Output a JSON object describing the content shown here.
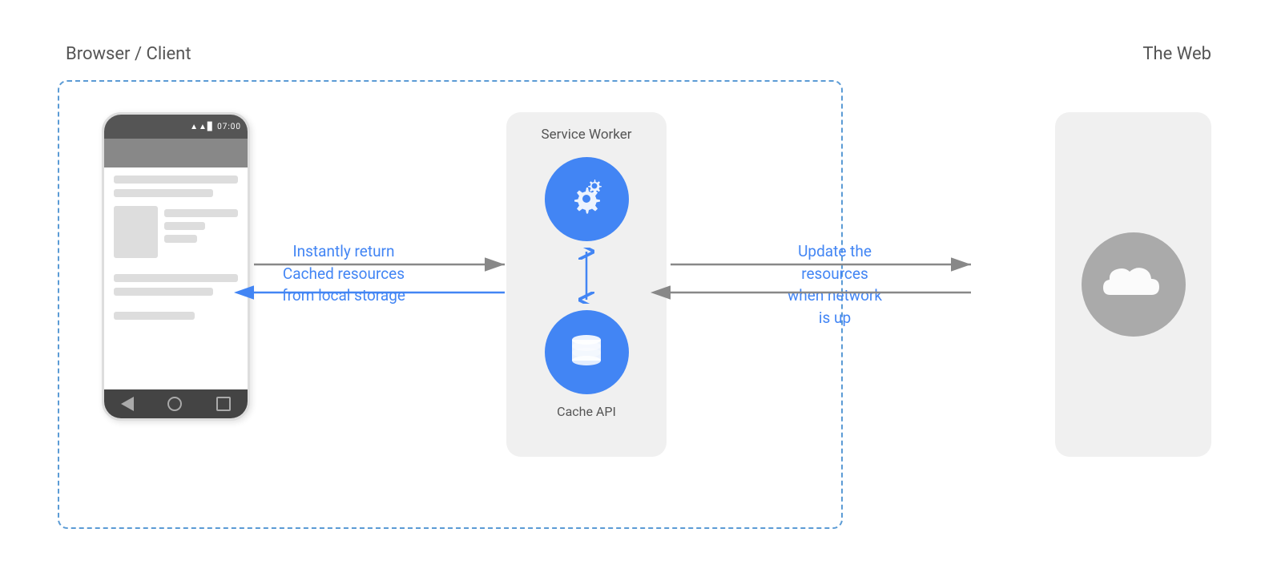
{
  "labels": {
    "browser_client": "Browser / Client",
    "the_web": "The Web",
    "service_worker": "Service Worker",
    "cache_api": "Cache API",
    "annotation_left_line1": "Instantly return",
    "annotation_left_line2": "Cached resources",
    "annotation_left_line3": "from local storage",
    "annotation_right_line1": "Update the",
    "annotation_right_line2": "resources",
    "annotation_right_line3": "when network",
    "annotation_right_line4": "is up"
  },
  "colors": {
    "blue": "#4285f4",
    "dashed_border": "#5b9bd5",
    "gray_box": "#f0f0f0",
    "cloud_bg": "#aaa",
    "arrow": "#888"
  }
}
